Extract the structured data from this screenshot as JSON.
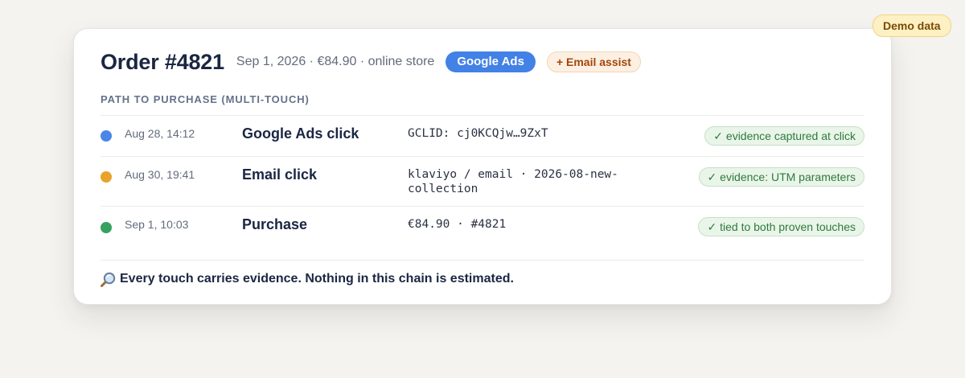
{
  "demo_badge": "Demo data",
  "order": {
    "title": "Order #4821",
    "meta": "Sep 1, 2026 · €84.90 · online store",
    "primary_channel": "Google Ads",
    "assist_channel": "+ Email assist"
  },
  "path": {
    "section_title": "PATH TO PURCHASE (MULTI-TOUCH)",
    "touches": [
      {
        "time": "Aug 28, 14:12",
        "event": "Google Ads click",
        "detail": "GCLID: cj0KCQjw…9ZxT",
        "evidence": "✓ evidence captured at click",
        "dot_color": "#4a86e8"
      },
      {
        "time": "Aug 30, 19:41",
        "event": "Email click",
        "detail": "klaviyo / email · 2026-08-new-collection",
        "evidence": "✓ evidence: UTM parameters",
        "dot_color": "#e8a32a"
      },
      {
        "time": "Sep 1, 10:03",
        "event": "Purchase",
        "detail": "€84.90 · #4821",
        "evidence": "✓ tied to both proven touches",
        "dot_color": "#36a160"
      }
    ]
  },
  "footer": {
    "icon": "magnifier-icon",
    "text": "Every touch carries evidence. Nothing in this chain is estimated."
  }
}
